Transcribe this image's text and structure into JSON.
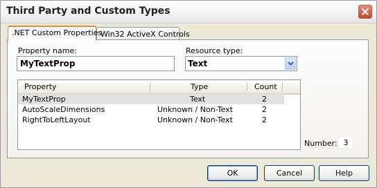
{
  "window": {
    "title": "Third Party and Custom Types"
  },
  "tabs": [
    {
      "label": ".NET Custom Properties"
    },
    {
      "label": "Win32 ActiveX Controls"
    }
  ],
  "form": {
    "property_name_label": "Property name:",
    "property_name_value": "MyTextProp",
    "resource_type_label": "Resource type:",
    "resource_type_value": "Text"
  },
  "list": {
    "columns": [
      "Property",
      "Type",
      "Count"
    ],
    "rows": [
      {
        "property": "MyTextProp",
        "type": "Text",
        "count": "2"
      },
      {
        "property": "AutoScaleDimensions",
        "type": "Unknown / Non-Text",
        "count": "2"
      },
      {
        "property": "RightToLeftLayout",
        "type": "Unknown / Non-Text",
        "count": "2"
      }
    ],
    "selected_row": 0
  },
  "number": {
    "label": "Number:",
    "value": "3"
  },
  "buttons": {
    "ok": "OK",
    "cancel": "Cancel",
    "help": "Help"
  },
  "colors": {
    "close_button": "#c7442d",
    "active_tab_accent": "#e68b2c",
    "field_border": "#7f9db9"
  },
  "icons": {
    "close": "close-icon",
    "dropdown": "chevron-down-icon"
  }
}
